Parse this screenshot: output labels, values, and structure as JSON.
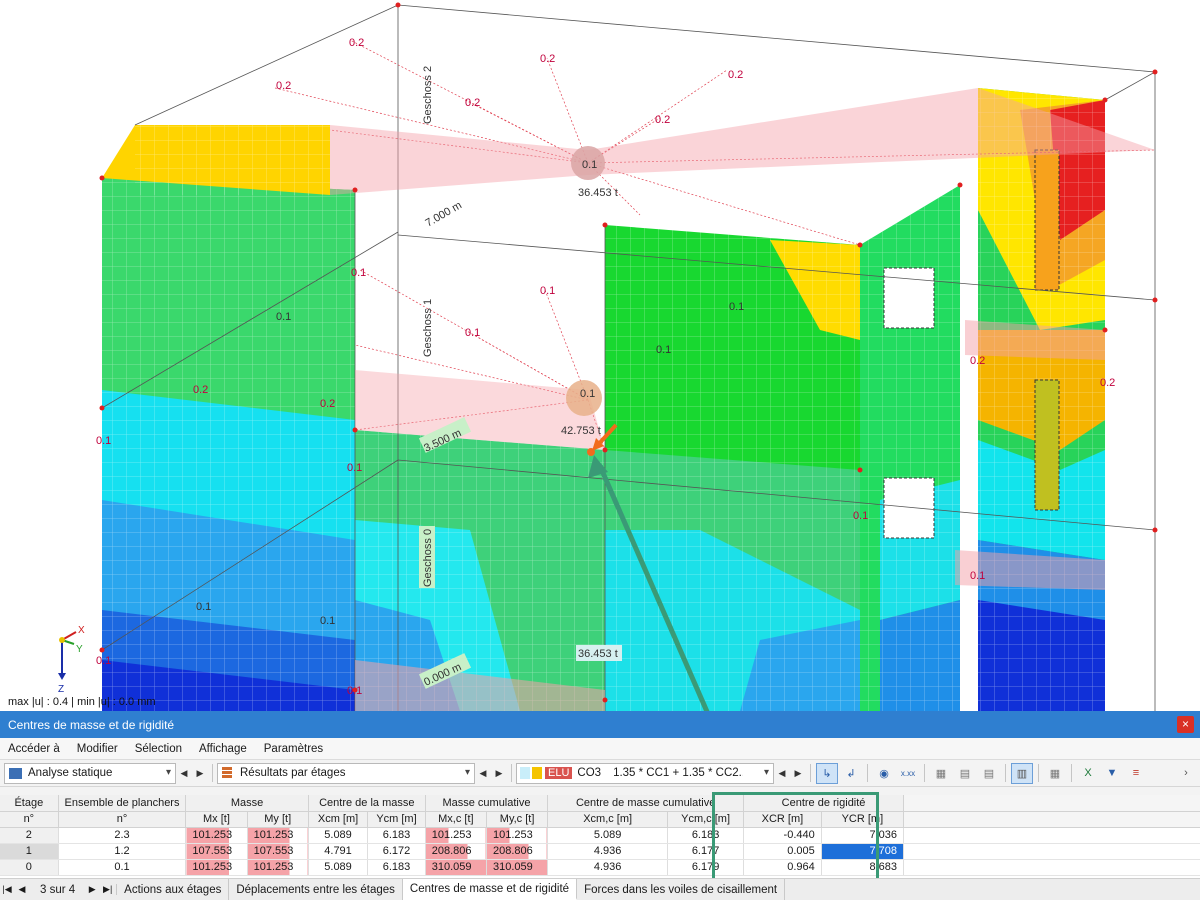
{
  "viewport": {
    "status_text": "max |u| : 0.4 | min |u| : 0.0 mm",
    "story_labels": [
      "Geschoss 2",
      "Geschoss 1",
      "Geschoss 0"
    ],
    "mass_labels": [
      "36.453 t",
      "42.753 t",
      "36.453 t"
    ],
    "dimension_labels": [
      "7.000 m",
      "3.500 m",
      "0.000 m"
    ],
    "contour_values": [
      "0.2",
      "0.1"
    ],
    "axis_labels": {
      "x": "X",
      "y": "Y",
      "z": "Z"
    }
  },
  "panel": {
    "title": "Centres de masse et de rigidité",
    "close": "×",
    "menu": [
      "Accéder à",
      "Modifier",
      "Sélection",
      "Affichage",
      "Paramètres"
    ],
    "analysis_combo": "Analyse statique",
    "results_combo": "Résultats par étages",
    "elu_badge": "ELU",
    "combination_id": "CO3",
    "combination_formula": "1.35 * CC1 + 1.35 * CC2..."
  },
  "table": {
    "group_headers": {
      "floor": "Étage",
      "floor_sets": "Ensemble de planchers",
      "mass": "Masse",
      "mass_centre": "Centre de la masse",
      "cumulative_mass": "Masse cumulative",
      "cumulative_centre": "Centre de masse cumulative",
      "stiffness_centre": "Centre de rigidité"
    },
    "sub_headers": {
      "floor_no": "n°",
      "floor_sets_no": "n°",
      "mx": "Mx [t]",
      "my": "My [t]",
      "xcm": "Xcm [m]",
      "ycm": "Ycm [m]",
      "mxc": "Mx,c [t]",
      "myc": "My,c [t]",
      "xcmc": "Xcm,c [m]",
      "ycmc": "Ycm,c [m]",
      "xcr": "XCR [m]",
      "ycr": "YCR [m]"
    },
    "rows": [
      {
        "floor": "2",
        "sets": "2.3",
        "mx": "101.253",
        "my": "101.253",
        "xcm": "5.089",
        "ycm": "6.183",
        "mxc": "101.253",
        "myc": "101.253",
        "xcmc": "5.089",
        "ycmc": "6.183",
        "xcr": "-0.440",
        "ycr": "7.036"
      },
      {
        "floor": "1",
        "sets": "1.2",
        "mx": "107.553",
        "my": "107.553",
        "xcm": "4.791",
        "ycm": "6.172",
        "mxc": "208.806",
        "myc": "208.806",
        "xcmc": "4.936",
        "ycmc": "6.177",
        "xcr": "0.005",
        "ycr": "7.708"
      },
      {
        "floor": "0",
        "sets": "0.1",
        "mx": "101.253",
        "my": "101.253",
        "xcm": "5.089",
        "ycm": "6.183",
        "mxc": "310.059",
        "myc": "310.059",
        "xcmc": "4.936",
        "ycmc": "6.179",
        "xcr": "0.964",
        "ycr": "8.683"
      }
    ]
  },
  "tabs": {
    "page_indicator": "3 sur 4",
    "items": [
      "Actions aux étages",
      "Déplacements entre les étages",
      "Centres de masse et de rigidité",
      "Forces dans les voiles de cisaillement"
    ]
  },
  "colors": {
    "title_bar": "#2f7fd0",
    "frame_highlight": "#3a9a76",
    "selected_cell": "#1e6fd9",
    "elu_badge": "#d9534f"
  }
}
